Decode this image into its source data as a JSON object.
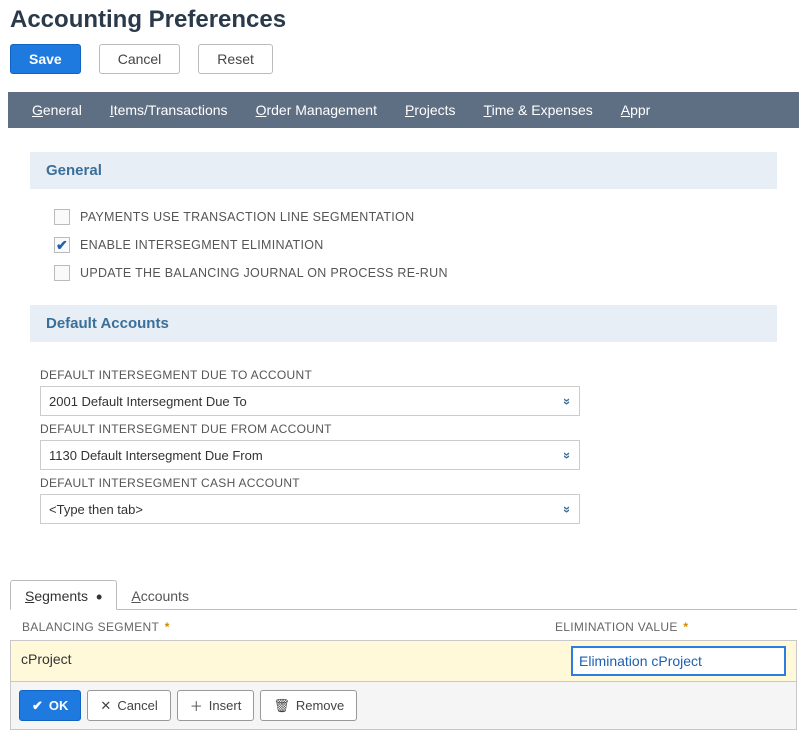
{
  "page": {
    "title": "Accounting Preferences"
  },
  "buttons": {
    "save": "Save",
    "cancel": "Cancel",
    "reset": "Reset"
  },
  "navtabs": {
    "general_pre": "G",
    "general_post": "eneral",
    "items_pre": "I",
    "items_post": "tems/Transactions",
    "order_pre": "O",
    "order_post": "rder Management",
    "projects_pre": "P",
    "projects_post": "rojects",
    "time_pre": "T",
    "time_post": "ime & Expenses",
    "appr_pre": "A",
    "appr_post": "ppr"
  },
  "section": {
    "general": "General",
    "default_accounts": "Default Accounts"
  },
  "checks": {
    "payments_line_seg": {
      "label": "PAYMENTS USE TRANSACTION LINE SEGMENTATION",
      "checked": ""
    },
    "enable_interseg": {
      "label": "ENABLE INTERSEGMENT ELIMINATION",
      "checked": "✔"
    },
    "update_balancing": {
      "label": "UPDATE THE BALANCING JOURNAL ON PROCESS RE-RUN",
      "checked": ""
    }
  },
  "fields": {
    "due_to": {
      "label": "DEFAULT INTERSEGMENT DUE TO ACCOUNT",
      "value": "2001 Default Intersegment Due To"
    },
    "due_from": {
      "label": "DEFAULT INTERSEGMENT DUE FROM ACCOUNT",
      "value": "1130 Default Intersegment Due From"
    },
    "cash": {
      "label": "DEFAULT INTERSEGMENT CASH ACCOUNT",
      "value": "<Type then tab>"
    }
  },
  "subtabs": {
    "segments_pre": "S",
    "segments_post": "egments",
    "accounts_pre": "A",
    "accounts_post": "ccounts"
  },
  "grid": {
    "col_balancing": "BALANCING SEGMENT",
    "col_elim": "ELIMINATION VALUE",
    "row": {
      "segment": "cProject",
      "elim_value": "Elimination cProject"
    },
    "actions": {
      "ok": "OK",
      "cancel": "Cancel",
      "insert": "Insert",
      "remove": "Remove"
    }
  },
  "icons": {
    "checkmark": "✔",
    "doublechevron": "»",
    "plus": "＋",
    "x": "✕",
    "trash": "🗑"
  }
}
